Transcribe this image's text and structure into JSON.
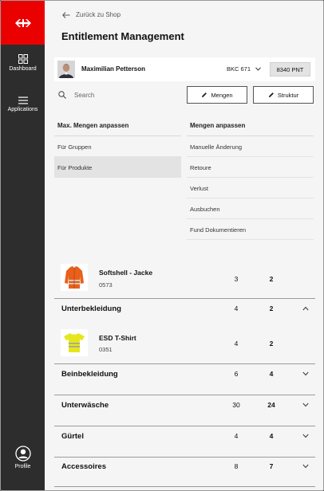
{
  "sidebar": {
    "nav": [
      {
        "label": "Dashboard",
        "icon": "dashboard-icon"
      },
      {
        "label": "Applications",
        "icon": "menu-icon"
      }
    ],
    "profile_label": "Profile",
    "brand_color": "#eb0000"
  },
  "header": {
    "back_label": "Zurück zu Shop",
    "title": "Entitlement Management"
  },
  "user": {
    "name": "Maximilian Petterson",
    "cost_center": "BKC 671",
    "points": "8340 PNT"
  },
  "toolbar": {
    "search_placeholder": "Search",
    "mengen_label": "Mengen",
    "struktur_label": "Struktur"
  },
  "menus": {
    "left": {
      "header": "Max. Mengen anpassen",
      "items": [
        "Für Gruppen",
        "Für Produkte"
      ],
      "selected": "Für Produkte"
    },
    "right": {
      "header": "Mengen anpassen",
      "items": [
        "Manuelle Änderung",
        "Retoure",
        "Verlust",
        "Ausbuchen",
        "Fund Dokumentieren"
      ]
    }
  },
  "products": [
    {
      "name": "Softshell - Jacke",
      "code": "0573",
      "max": "3",
      "current": "2",
      "color": "#e8601c"
    },
    {
      "name": "ESD T-Shirt",
      "code": "0351",
      "max": "4",
      "current": "2",
      "color": "#e6e61c"
    }
  ],
  "categories": [
    {
      "name": "Unterbekleidung",
      "max": "4",
      "current": "2",
      "expanded": true
    },
    {
      "name": "Beinbekleidung",
      "max": "6",
      "current": "4",
      "expanded": false
    },
    {
      "name": "Unterwäsche",
      "max": "30",
      "current": "24",
      "expanded": false
    },
    {
      "name": "Gürtel",
      "max": "4",
      "current": "4",
      "expanded": false
    },
    {
      "name": "Accessoires",
      "max": "8",
      "current": "7",
      "expanded": false
    }
  ]
}
